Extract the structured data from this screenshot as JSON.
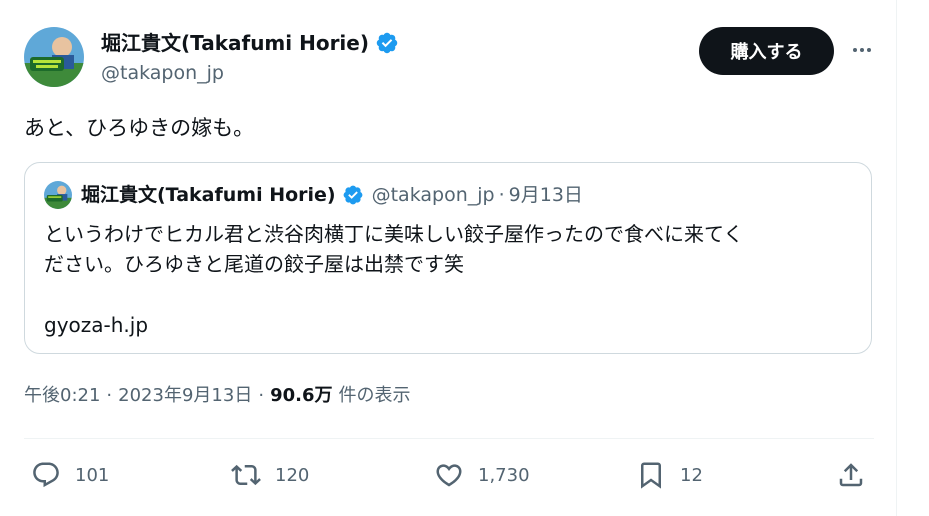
{
  "author": {
    "name": "堀江貴文(Takafumi Horie)",
    "handle": "@takapon_jp"
  },
  "buy_button": {
    "label": "購入する"
  },
  "tweet": {
    "text": "あと、ひろゆきの嫁も。"
  },
  "quoted": {
    "name": "堀江貴文(Takafumi Horie)",
    "handle": "@takapon_jp",
    "separator": "·",
    "date": "9月13日",
    "text_line1": "というわけでヒカル君と渋谷肉横丁に美味しい餃子屋作ったので食べに来てく",
    "text_line2": "ださい。ひろゆきと尾道の餃子屋は出禁です笑",
    "link": "gyoza-h.jp"
  },
  "meta": {
    "time": "午後0:21",
    "sep": "·",
    "date": "2023年9月13日",
    "views": "90.6万",
    "views_label": "件の表示"
  },
  "actions": {
    "replies": "101",
    "reposts": "120",
    "likes": "1,730",
    "bookmarks": "12"
  },
  "icons": {
    "verified": "verified-badge-icon",
    "more": "more-icon",
    "reply": "reply-icon",
    "repost": "repost-icon",
    "like": "heart-icon",
    "bookmark": "bookmark-icon",
    "share": "share-icon"
  },
  "colors": {
    "verified": "#1d9bf0",
    "text": "#0f1419",
    "secondary": "#536471",
    "button_bg": "#0f1419"
  }
}
